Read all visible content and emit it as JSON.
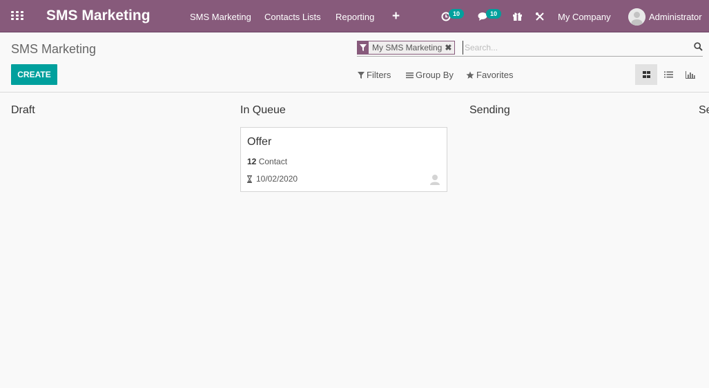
{
  "navbar": {
    "app_title": "SMS Marketing",
    "menu": [
      "SMS Marketing",
      "Contacts Lists",
      "Reporting"
    ],
    "activity_badge": "10",
    "messages_badge": "10",
    "company": "My Company",
    "user": "Administrator",
    "colors": {
      "bar": "#875a7b",
      "badge": "#00a09d"
    }
  },
  "control_panel": {
    "breadcrumb": "SMS Marketing",
    "search": {
      "facet_label": "My SMS Marketing",
      "placeholder": "Search..."
    },
    "create_label": "CREATE",
    "filters_label": "Filters",
    "group_by_label": "Group By",
    "favorites_label": "Favorites",
    "views": [
      "kanban",
      "list",
      "graph"
    ],
    "active_view": "kanban"
  },
  "kanban": {
    "columns": [
      "Draft",
      "In Queue",
      "Sending",
      "Se"
    ],
    "card": {
      "title": "Offer",
      "contact_count": "12",
      "contact_label": "Contact",
      "date": "10/02/2020"
    }
  },
  "icons": [
    "apps-grid-icon",
    "activity-clock-icon",
    "chat-icon",
    "gift-icon",
    "debug-tools-icon",
    "filter-icon",
    "close-icon",
    "search-icon",
    "list-icon",
    "star-icon",
    "kanban-icon",
    "bar-chart-icon",
    "hourglass-icon",
    "user-icon"
  ]
}
